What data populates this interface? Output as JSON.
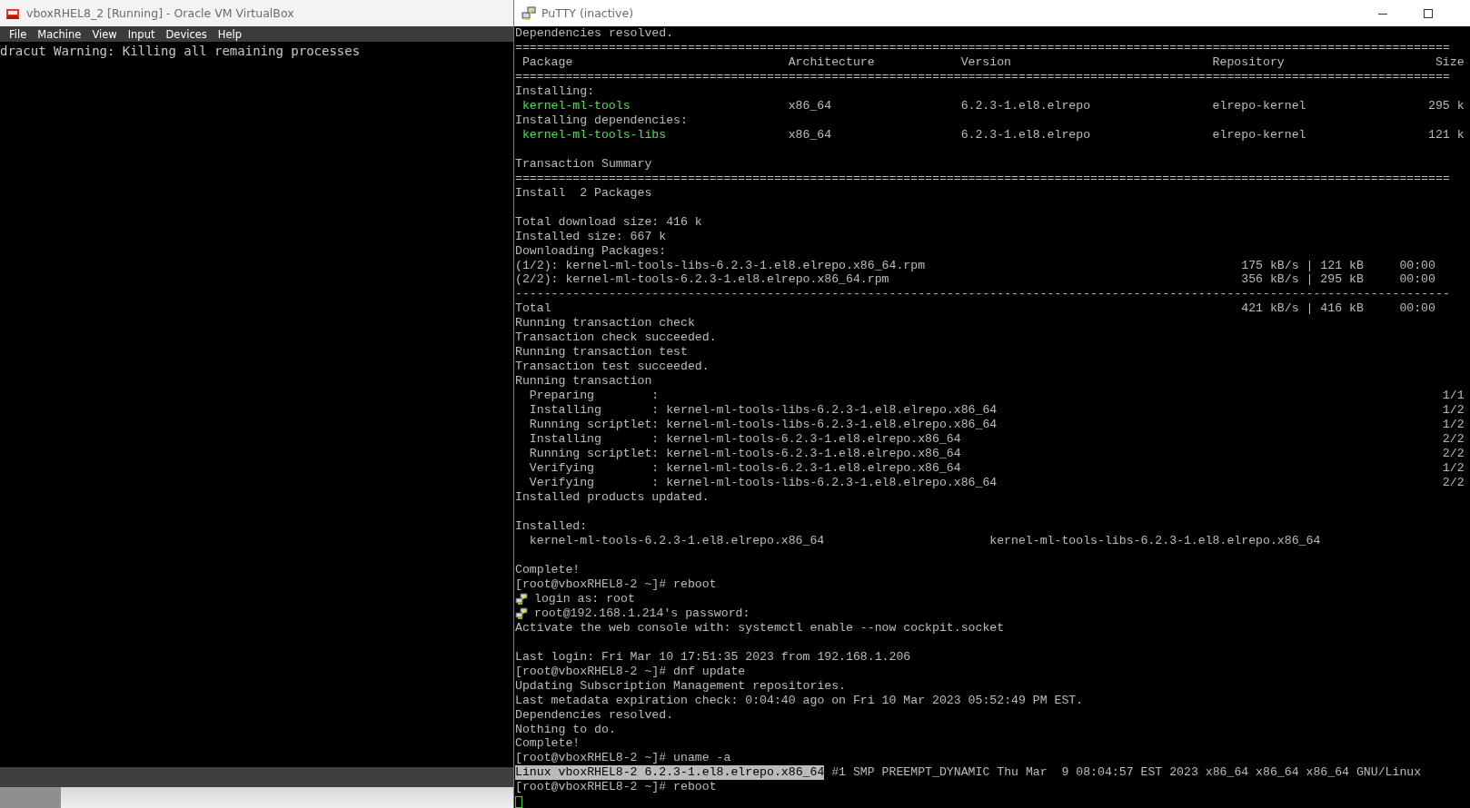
{
  "virtualbox": {
    "title": "vboxRHEL8_2 [Running] - Oracle VM VirtualBox",
    "menu": [
      "File",
      "Machine",
      "View",
      "Input",
      "Devices",
      "Help"
    ],
    "screen_lines": [
      "dracut Warning: Killing all remaining processes"
    ]
  },
  "putty": {
    "title": "PuTTY (inactive)",
    "lines": [
      {
        "kind": "text",
        "text": "Dependencies resolved."
      },
      {
        "kind": "rule",
        "text": "=================================================================================================================================="
      },
      {
        "kind": "header",
        "cells": [
          "Package",
          "Architecture",
          "Version",
          "Repository",
          "Size"
        ]
      },
      {
        "kind": "rule",
        "text": "=================================================================================================================================="
      },
      {
        "kind": "text",
        "text": "Installing:"
      },
      {
        "kind": "package",
        "name": "kernel-ml-tools",
        "arch": "x86_64",
        "version": "6.2.3-1.el8.elrepo",
        "repo": "elrepo-kernel",
        "size": "295 k"
      },
      {
        "kind": "text",
        "text": "Installing dependencies:"
      },
      {
        "kind": "package",
        "name": "kernel-ml-tools-libs",
        "arch": "x86_64",
        "version": "6.2.3-1.el8.elrepo",
        "repo": "elrepo-kernel",
        "size": "121 k"
      },
      {
        "kind": "blank"
      },
      {
        "kind": "text",
        "text": "Transaction Summary"
      },
      {
        "kind": "rule",
        "text": "=================================================================================================================================="
      },
      {
        "kind": "text",
        "text": "Install  2 Packages"
      },
      {
        "kind": "blank"
      },
      {
        "kind": "text",
        "text": "Total download size: 416 k"
      },
      {
        "kind": "text",
        "text": "Installed size: 667 k"
      },
      {
        "kind": "text",
        "text": "Downloading Packages:"
      },
      {
        "kind": "transfer",
        "label": "(1/2): kernel-ml-tools-libs-6.2.3-1.el8.elrepo.x86_64.rpm",
        "rate": "175 kB/s | 121 kB",
        "time": "00:00"
      },
      {
        "kind": "transfer",
        "label": "(2/2): kernel-ml-tools-6.2.3-1.el8.elrepo.x86_64.rpm",
        "rate": "356 kB/s | 295 kB",
        "time": "00:00"
      },
      {
        "kind": "rule",
        "text": "----------------------------------------------------------------------------------------------------------------------------------"
      },
      {
        "kind": "transfer",
        "label": "Total",
        "rate": "421 kB/s | 416 kB",
        "time": "00:00"
      },
      {
        "kind": "text",
        "text": "Running transaction check"
      },
      {
        "kind": "text",
        "text": "Transaction check succeeded."
      },
      {
        "kind": "text",
        "text": "Running transaction test"
      },
      {
        "kind": "text",
        "text": "Transaction test succeeded."
      },
      {
        "kind": "text",
        "text": "Running transaction"
      },
      {
        "kind": "step",
        "label": "Preparing        :",
        "count": "1/1"
      },
      {
        "kind": "step",
        "label": "Installing       :",
        "package": "kernel-ml-tools-libs-6.2.3-1.el8.elrepo.x86_64",
        "count": "1/2"
      },
      {
        "kind": "step",
        "label": "Running scriptlet:",
        "package": "kernel-ml-tools-libs-6.2.3-1.el8.elrepo.x86_64",
        "count": "1/2"
      },
      {
        "kind": "step",
        "label": "Installing       :",
        "package": "kernel-ml-tools-6.2.3-1.el8.elrepo.x86_64",
        "count": "2/2"
      },
      {
        "kind": "step",
        "label": "Running scriptlet:",
        "package": "kernel-ml-tools-6.2.3-1.el8.elrepo.x86_64",
        "count": "2/2"
      },
      {
        "kind": "step",
        "label": "Verifying        :",
        "package": "kernel-ml-tools-6.2.3-1.el8.elrepo.x86_64",
        "count": "1/2"
      },
      {
        "kind": "step",
        "label": "Verifying        :",
        "package": "kernel-ml-tools-libs-6.2.3-1.el8.elrepo.x86_64",
        "count": "2/2"
      },
      {
        "kind": "text",
        "text": "Installed products updated."
      },
      {
        "kind": "blank"
      },
      {
        "kind": "text",
        "text": "Installed:"
      },
      {
        "kind": "installed",
        "items": [
          "kernel-ml-tools-6.2.3-1.el8.elrepo.x86_64",
          "kernel-ml-tools-libs-6.2.3-1.el8.elrepo.x86_64"
        ]
      },
      {
        "kind": "blank"
      },
      {
        "kind": "text",
        "text": "Complete!"
      },
      {
        "kind": "text",
        "text": "[root@vboxRHEL8-2 ~]# reboot"
      },
      {
        "kind": "putty_msg",
        "text": "login as: root"
      },
      {
        "kind": "putty_msg",
        "text": "root@192.168.1.214's password:"
      },
      {
        "kind": "text",
        "text": "Activate the web console with: systemctl enable --now cockpit.socket"
      },
      {
        "kind": "blank"
      },
      {
        "kind": "text",
        "text": "Last login: Fri Mar 10 17:51:35 2023 from 192.168.1.206"
      },
      {
        "kind": "text",
        "text": "[root@vboxRHEL8-2 ~]# dnf update"
      },
      {
        "kind": "text",
        "text": "Updating Subscription Management repositories."
      },
      {
        "kind": "text",
        "text": "Last metadata expiration check: 0:04:40 ago on Fri 10 Mar 2023 05:52:49 PM EST."
      },
      {
        "kind": "text",
        "text": "Dependencies resolved."
      },
      {
        "kind": "text",
        "text": "Nothing to do."
      },
      {
        "kind": "text",
        "text": "Complete!"
      },
      {
        "kind": "text",
        "text": "[root@vboxRHEL8-2 ~]# uname -a"
      },
      {
        "kind": "segments",
        "segments": [
          {
            "text": "Linux vboxRHEL8-2 6.2.3-1.el8.elrepo.x86_64",
            "selected": true
          },
          {
            "text": " #1 SMP PREEMPT_DYNAMIC Thu Mar  9 08:04:57 EST 2023 x86_64 x86_64 x86_64 GNU/Linux",
            "selected": false
          }
        ]
      },
      {
        "kind": "text",
        "text": "[root@vboxRHEL8-2 ~]# reboot"
      },
      {
        "kind": "cursor"
      }
    ]
  }
}
